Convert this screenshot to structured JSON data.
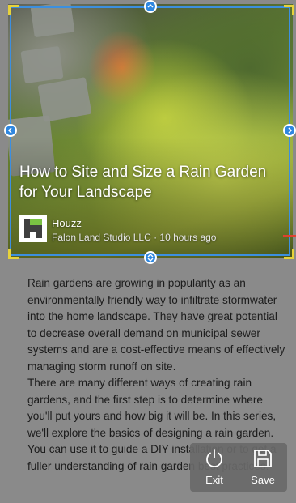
{
  "hero": {
    "title": "How to Site and Size a Rain Garden for Your Landscape",
    "source_name": "Houzz",
    "source_meta": "Falon Land Studio LLC · 10 hours ago",
    "logo_icon": "houzz-logo-icon"
  },
  "article": {
    "paragraphs": [
      "Rain gardens are growing in popularity as an environmentally friendly way to infiltrate stormwater into the home landscape. They have great potential to decrease overall demand on municipal sewer systems and are a cost-effective means of effectively managing storm runoff on site.",
      "There are many different ways of creating rain gardens, and the first step is to determine where you'll put yours and how big it will be. In this series, we'll explore the basics of designing a rain garden. You can use it to guide a DIY installation or to get a fuller understanding of rain garden best practices."
    ]
  },
  "actions": {
    "exit_label": "Exit",
    "save_label": "Save"
  },
  "colors": {
    "crop_frame": "#3c8fe0",
    "corner_marks": "#e7d23b"
  }
}
